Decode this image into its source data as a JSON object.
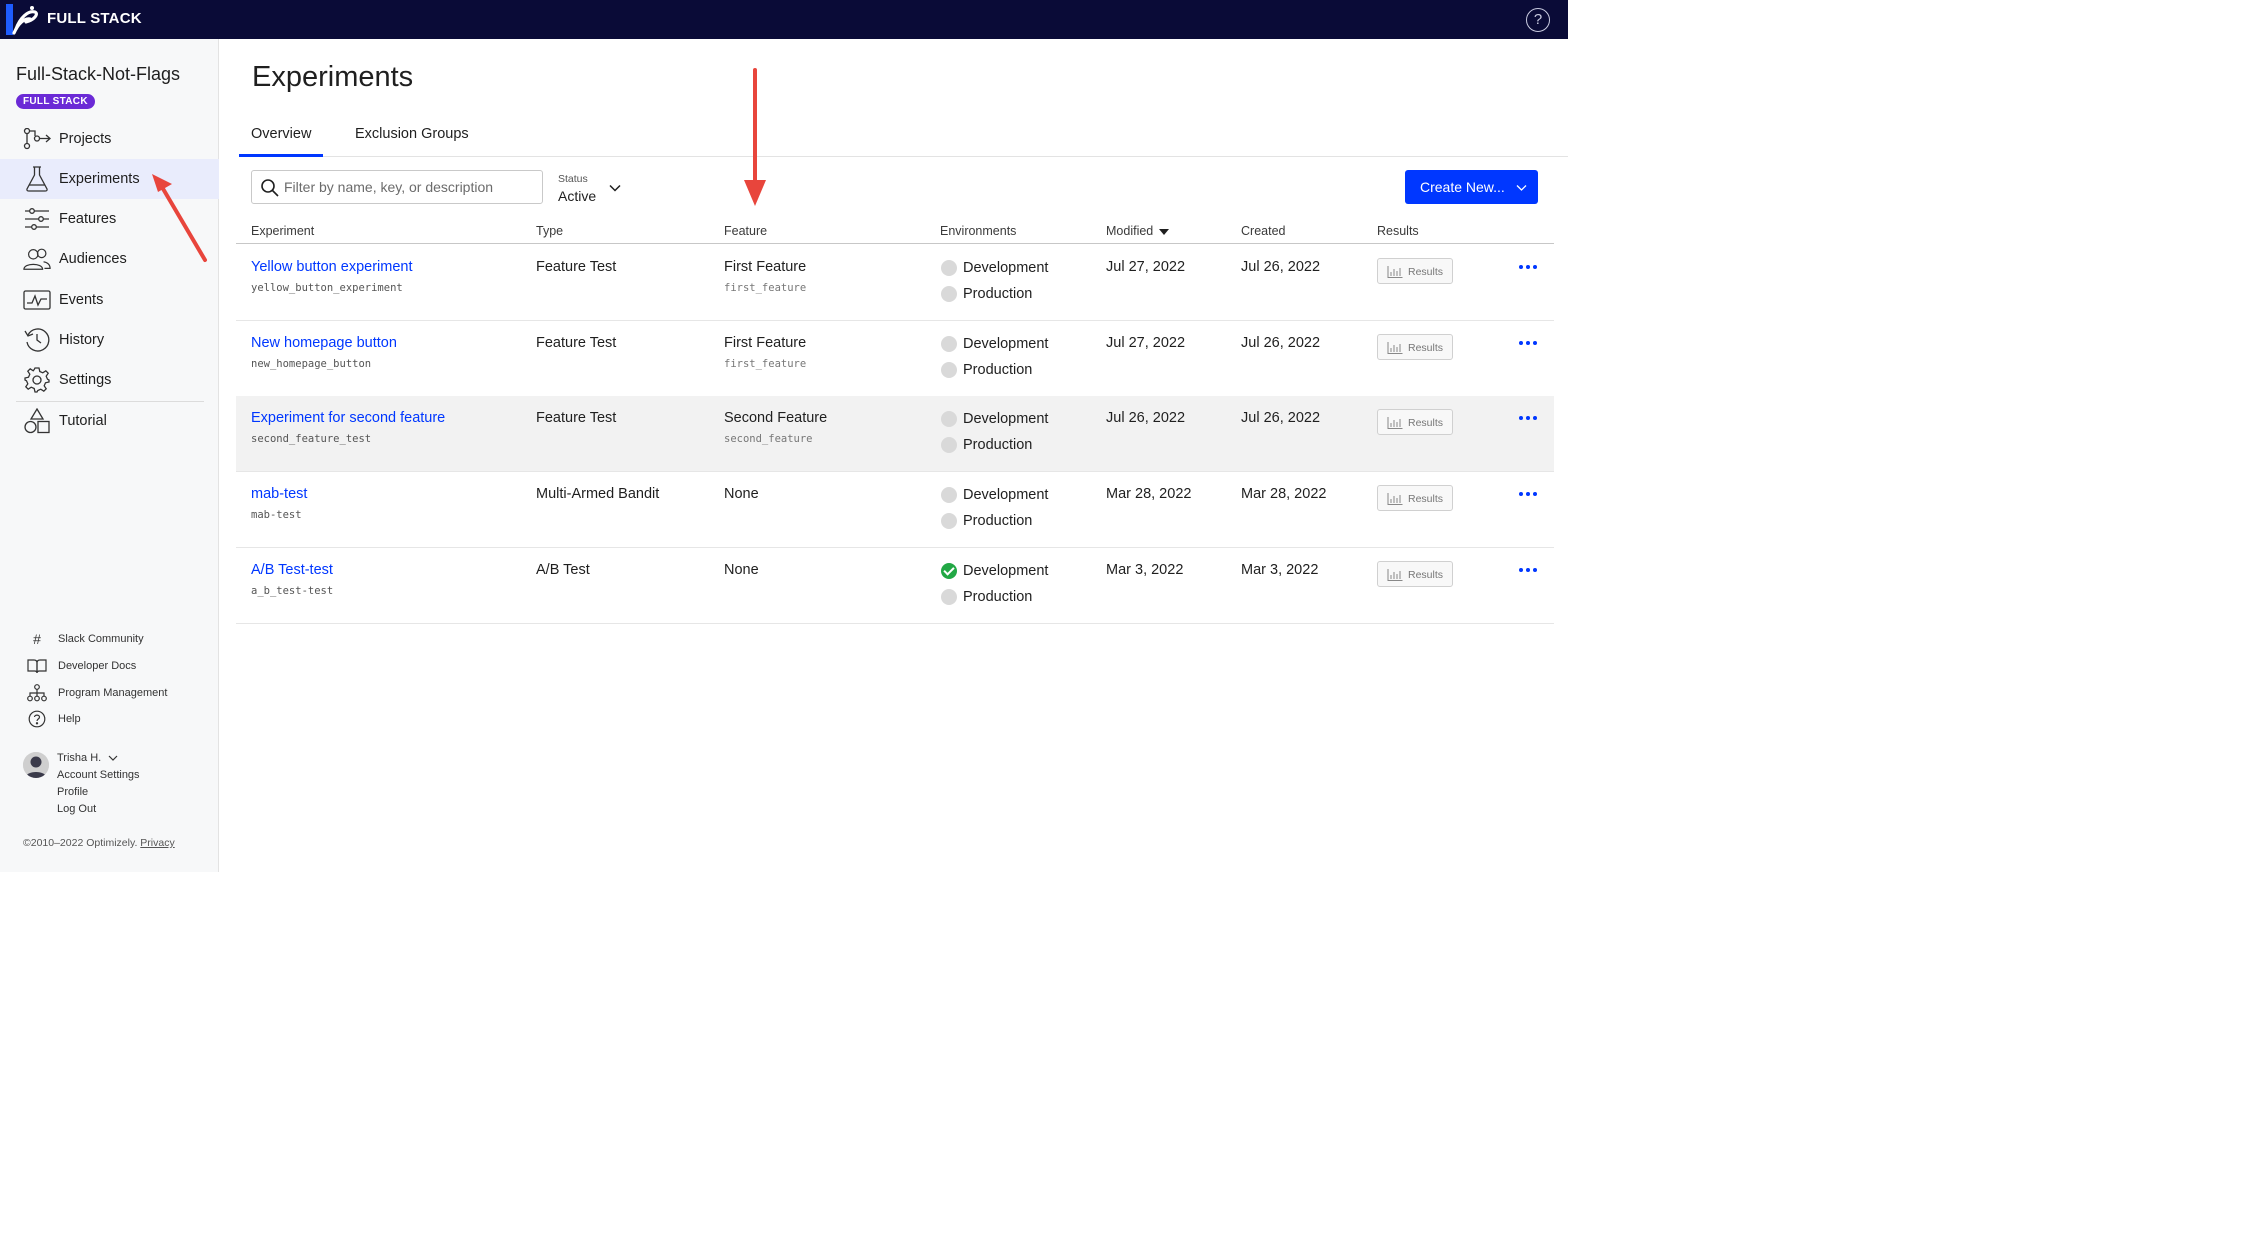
{
  "colors": {
    "topbar": "#0a0b37",
    "accent": "#0037ff",
    "badge": "#6b2ad6",
    "success": "#22a845",
    "annotation": "#e8453c"
  },
  "brand": {
    "name": "FULL STACK"
  },
  "topbar": {
    "help_icon": "help-icon"
  },
  "sidebar": {
    "project_name": "Full-Stack-Not-Flags",
    "badge": "FULL STACK",
    "nav": [
      {
        "label": "Projects",
        "icon": "projects-icon"
      },
      {
        "label": "Experiments",
        "icon": "flask-icon",
        "active": true
      },
      {
        "label": "Features",
        "icon": "sliders-icon"
      },
      {
        "label": "Audiences",
        "icon": "users-icon"
      },
      {
        "label": "Events",
        "icon": "chart-window-icon"
      },
      {
        "label": "History",
        "icon": "history-icon"
      },
      {
        "label": "Settings",
        "icon": "gear-icon"
      },
      {
        "label": "Tutorial",
        "icon": "shapes-icon"
      }
    ],
    "footer": [
      {
        "label": "Slack Community",
        "icon": "hash-icon"
      },
      {
        "label": "Developer Docs",
        "icon": "book-icon"
      },
      {
        "label": "Program Management",
        "icon": "org-chart-icon"
      },
      {
        "label": "Help",
        "icon": "help-circle-icon"
      }
    ],
    "user": {
      "name": "Trisha H.",
      "links": [
        "Account Settings",
        "Profile",
        "Log Out"
      ]
    },
    "copyright": "©2010–2022 Optimizely.",
    "privacy": "Privacy"
  },
  "main": {
    "title": "Experiments",
    "tabs": [
      "Overview",
      "Exclusion Groups"
    ],
    "search_placeholder": "Filter by name, key, or description",
    "status": {
      "label": "Status",
      "value": "Active"
    },
    "create_button": "Create New...",
    "columns": [
      "Experiment",
      "Type",
      "Feature",
      "Environments",
      "Modified",
      "Created",
      "Results"
    ],
    "rows": [
      {
        "name": "Yellow button experiment",
        "key": "yellow_button_experiment",
        "type": "Feature Test",
        "feature": "First Feature",
        "feature_key": "first_feature",
        "envs": [
          {
            "name": "Development",
            "running": false
          },
          {
            "name": "Production",
            "running": false
          }
        ],
        "modified": "Jul 27, 2022",
        "created": "Jul 26, 2022",
        "results": "Results"
      },
      {
        "name": "New homepage button",
        "key": "new_homepage_button",
        "type": "Feature Test",
        "feature": "First Feature",
        "feature_key": "first_feature",
        "envs": [
          {
            "name": "Development",
            "running": false
          },
          {
            "name": "Production",
            "running": false
          }
        ],
        "modified": "Jul 27, 2022",
        "created": "Jul 26, 2022",
        "results": "Results"
      },
      {
        "name": "Experiment for second feature",
        "key": "second_feature_test",
        "type": "Feature Test",
        "feature": "Second Feature",
        "feature_key": "second_feature",
        "envs": [
          {
            "name": "Development",
            "running": false
          },
          {
            "name": "Production",
            "running": false
          }
        ],
        "modified": "Jul 26, 2022",
        "created": "Jul 26, 2022",
        "results": "Results",
        "highlighted": true
      },
      {
        "name": "mab-test",
        "key": "mab-test",
        "type": "Multi-Armed Bandit",
        "feature": "None",
        "feature_key": "",
        "envs": [
          {
            "name": "Development",
            "running": false
          },
          {
            "name": "Production",
            "running": false
          }
        ],
        "modified": "Mar 28, 2022",
        "created": "Mar 28, 2022",
        "results": "Results"
      },
      {
        "name": "A/B Test-test",
        "key": "a_b_test-test",
        "type": "A/B Test",
        "feature": "None",
        "feature_key": "",
        "envs": [
          {
            "name": "Development",
            "running": true
          },
          {
            "name": "Production",
            "running": false
          }
        ],
        "modified": "Mar 3, 2022",
        "created": "Mar 3, 2022",
        "results": "Results"
      }
    ]
  }
}
